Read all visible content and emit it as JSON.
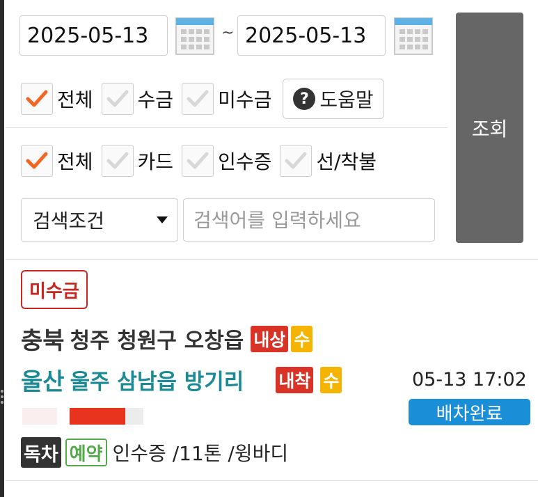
{
  "filters": {
    "start_date": "2025-05-13",
    "end_date": "2025-05-13",
    "date_separator": "~",
    "search_button_label": "조회",
    "payment_checks": [
      {
        "label": "전체",
        "checked": true
      },
      {
        "label": "수금",
        "checked": false
      },
      {
        "label": "미수금",
        "checked": false
      }
    ],
    "help_label": "도움말",
    "type_checks": [
      {
        "label": "전체",
        "checked": true
      },
      {
        "label": "카드",
        "checked": false
      },
      {
        "label": "인수증",
        "checked": false
      },
      {
        "label": "선/착불",
        "checked": false
      }
    ],
    "search_condition": "검색조건",
    "search_placeholder": "검색어를 입력하세요"
  },
  "order": {
    "status_badge": "미수금",
    "origin": {
      "province": "충북",
      "detail": "청주 청원구 오창읍",
      "tag_load": "내상",
      "tag_hand": "수"
    },
    "destination": {
      "province": "울산",
      "detail": "울주 삼남읍 방기리",
      "tag_unload": "내착",
      "tag_hand": "수"
    },
    "time": "05-13 17:02",
    "dispatch_status": "배차완료",
    "tag_exclusive": "독차",
    "tag_reserve": "예약",
    "details": "인수증 /11톤 /윙바디"
  },
  "colors": {
    "accent_check": "#f26522",
    "origin_text": "#333333",
    "destination_text": "#1a8a96",
    "status_red": "#c8261e",
    "dispatch_blue": "#1a8fd8"
  }
}
